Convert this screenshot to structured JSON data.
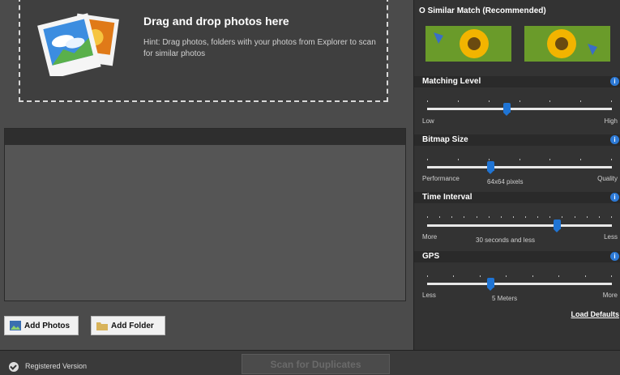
{
  "dropzone": {
    "title": "Drag and drop photos here",
    "hint": "Hint: Drag photos, folders with your photos from Explorer to scan for similar photos"
  },
  "buttons": {
    "add_photos": "Add Photos",
    "add_folder": "Add Folder",
    "scan": "Scan for Duplicates"
  },
  "right_panel": {
    "match_mode": "Similar Match (Recommended)",
    "sections": [
      {
        "title": "Matching Level",
        "left": "Low",
        "right": "High",
        "value_label": "",
        "position": 0.43
      },
      {
        "title": "Bitmap Size",
        "left": "Performance",
        "right": "Quality",
        "value_label": "64x64 pixels",
        "position": 0.34
      },
      {
        "title": "Time Interval",
        "left": "More",
        "right": "Less",
        "value_label": "30 seconds and less",
        "position": 0.7
      },
      {
        "title": "GPS",
        "left": "Less",
        "right": "More",
        "value_label": "5 Meters",
        "position": 0.34
      }
    ],
    "load_defaults": "Load Defaults"
  },
  "status": {
    "registered": "Registered Version"
  },
  "colors": {
    "accent": "#1f74d4",
    "panel": "#333333",
    "background": "#4a4a4a"
  }
}
